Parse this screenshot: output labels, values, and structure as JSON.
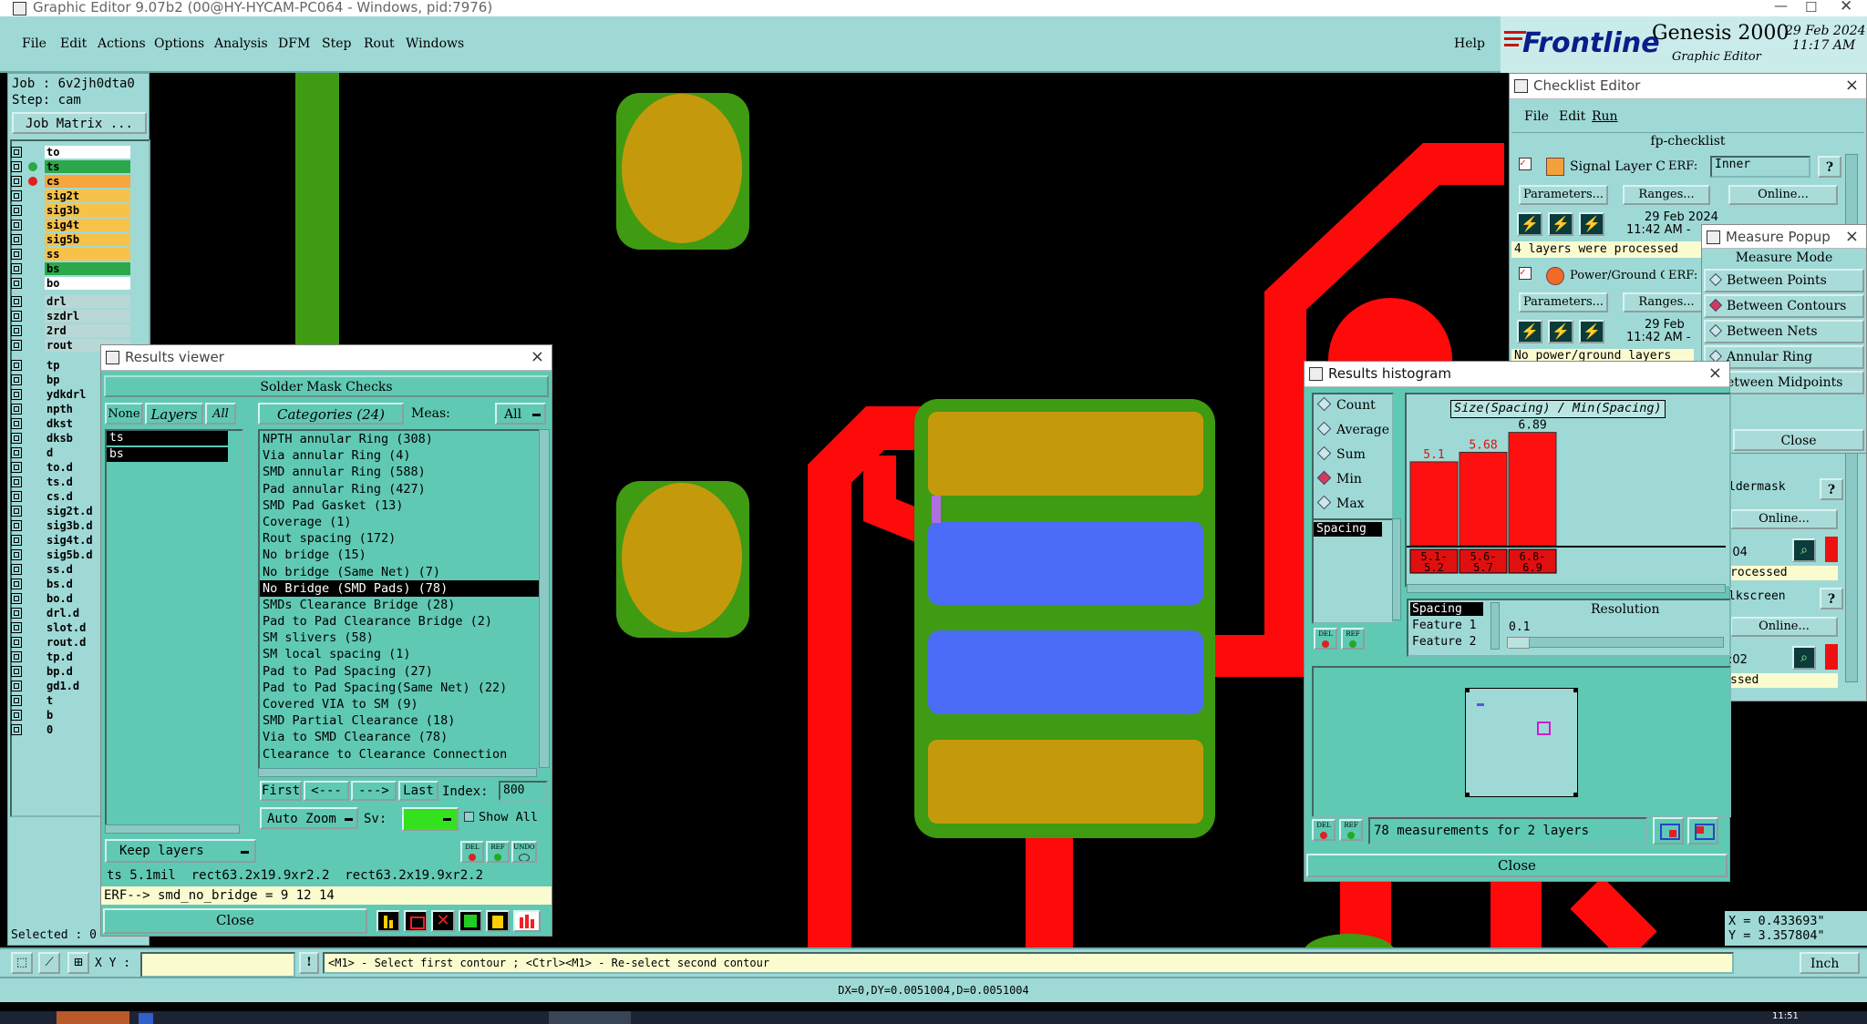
{
  "os_titlebar": "Graphic Editor 9.07b2 (00@HY-HYCAM-PC064 - Windows, pid:7976)",
  "menu": [
    "File",
    "Edit",
    "Actions",
    "Options",
    "Analysis",
    "DFM",
    "Step",
    "Rout",
    "Windows"
  ],
  "help_label": "Help",
  "brand": {
    "logo": "Frontline",
    "product": "Genesis 2000",
    "subtitle": "Graphic Editor",
    "date": "29 Feb 2024",
    "time": "11:17 AM"
  },
  "job": {
    "job_label": "Job : 6v2jh0dta0",
    "step_label": "Step: cam",
    "matrix_button": "Job Matrix ..."
  },
  "layers_group1": [
    {
      "name": "to",
      "color": "#ffffff",
      "dot": ""
    },
    {
      "name": "ts",
      "color": "#2aa84a",
      "dot": "#2aa84a"
    },
    {
      "name": "cs",
      "color": "#f6a63a",
      "dot": "#e02020"
    },
    {
      "name": "sig2t",
      "color": "#f6c24a",
      "dot": ""
    },
    {
      "name": "sig3b",
      "color": "#f6c24a",
      "dot": ""
    },
    {
      "name": "sig4t",
      "color": "#f6c24a",
      "dot": ""
    },
    {
      "name": "sig5b",
      "color": "#f6c24a",
      "dot": ""
    },
    {
      "name": "ss",
      "color": "#f6c24a",
      "dot": ""
    },
    {
      "name": "bs",
      "color": "#2aa84a",
      "dot": ""
    },
    {
      "name": "bo",
      "color": "#ffffff",
      "dot": ""
    }
  ],
  "layers_group2": [
    "drl",
    "szdrl",
    "2rd",
    "rout"
  ],
  "layers_group3": [
    "tp",
    "bp",
    "ydkdrl",
    "npth",
    "dkst",
    "dksb",
    "d",
    "to.d",
    "ts.d",
    "cs.d",
    "sig2t.d",
    "sig3b.d",
    "sig4t.d",
    "sig5b.d",
    "ss.d",
    "bs.d",
    "bo.d",
    "drl.d",
    "slot.d",
    "rout.d",
    "tp.d",
    "bp.d",
    "gd1.d",
    "t",
    "b",
    "0"
  ],
  "selected_label": "Selected : 0",
  "results_viewer": {
    "title": "Results viewer",
    "header": "Solder Mask Checks",
    "none_btn": "None",
    "layers_btn": "Layers",
    "all_btn": "All",
    "layers": [
      "ts",
      "bs"
    ],
    "categories_btn": "Categories (24)",
    "meas_label": "Meas:",
    "meas_value": "All",
    "categories": [
      "NPTH annular Ring (308)",
      "Via annular Ring (4)",
      "SMD annular Ring (588)",
      "Pad annular Ring (427)",
      "SMD Pad Gasket (13)",
      "Coverage (1)",
      "Rout spacing (172)",
      "No bridge (15)",
      "No bridge (Same Net) (7)",
      "No Bridge (SMD Pads) (78)",
      "SMDs Clearance Bridge (28)",
      "Pad to Pad Clearance Bridge (2)",
      "SM slivers (58)",
      "SM local spacing (1)",
      "Pad to Pad Spacing (27)",
      "Pad to Pad Spacing(Same Net) (22)",
      "Covered VIA to SM (9)",
      "SMD Partial Clearance (18)",
      "Via to SMD Clearance (78)",
      "Clearance to Clearance Connection"
    ],
    "selected_category": "No Bridge (SMD Pads) (78)",
    "nav": {
      "first": "First",
      "prev": "<---",
      "next": "--->",
      "last": "Last",
      "index_label": "Index:",
      "index_value": "800"
    },
    "auto_zoom": "Auto Zoom",
    "sv_label": "Sv:",
    "show_all": "Show All",
    "keep_layers": "Keep layers",
    "icon_labels": [
      "DEL",
      "REF",
      "UNDO"
    ],
    "info_line": "ts 5.1mil  rect63.2x19.9xr2.2  rect63.2x19.9xr2.2",
    "erf_line": "ERF--> smd_no_bridge = 9 12 14",
    "close": "Close"
  },
  "checklist": {
    "title": "Checklist Editor",
    "menu": [
      "File",
      "Edit",
      "Run"
    ],
    "name": "fp-checklist",
    "items": [
      {
        "label": "Signal Layer Ch",
        "erf": "ERF:",
        "erf_value": "Inner",
        "params": "Parameters...",
        "ranges": "Ranges...",
        "online": "Online...",
        "date": "29 Feb 2024",
        "time": "11:42 AM -",
        "status": "4 layers were processed"
      },
      {
        "label": "Power/Ground C",
        "erf": "ERF:",
        "erf_value": "",
        "params": "Parameters...",
        "ranges": "Ranges...",
        "online": "Online...",
        "date": "29 Feb",
        "time": "11:42 AM -",
        "status": "No power/ground layers"
      }
    ],
    "right_fragments": [
      "ldermask",
      "Online...",
      ":04",
      "rocessed",
      "lkscreen",
      "Online...",
      ":02",
      "ssed"
    ]
  },
  "measure_popup": {
    "title": "Measure Popup",
    "mode_label": "Measure Mode",
    "modes": [
      "Between Points",
      "Between Contours",
      "Between Nets",
      "Annular Ring",
      "etween Midpoints"
    ],
    "selected_mode": "Between Contours",
    "close": "Close"
  },
  "histogram": {
    "title": "Results histogram",
    "modes": [
      "Count",
      "Average",
      "Sum",
      "Min",
      "Max"
    ],
    "selected_mode": "Min",
    "list_item": "Spacing",
    "chart_title": "Size(Spacing) / Min(Spacing)",
    "fields": [
      "Spacing",
      "Feature 1",
      "Feature 2"
    ],
    "resolution_label": "Resolution",
    "resolution_value": "0.1",
    "measurements": "78 measurements for 2 layers",
    "close": "Close",
    "icon_labels": [
      "DEL",
      "REF"
    ]
  },
  "chart_data": {
    "type": "bar",
    "title": "Size(Spacing) / Min(Spacing)",
    "categories": [
      "5.1-5.2",
      "5.6-5.7",
      "6.8-6.9"
    ],
    "category_lines": [
      [
        "5.1-",
        "5.2"
      ],
      [
        "5.6-",
        "5.7"
      ],
      [
        "6.8-",
        "6.9"
      ]
    ],
    "values": [
      5.1,
      5.68,
      6.89
    ],
    "value_labels": [
      "5.1",
      "5.68",
      "6.89"
    ],
    "color": "#ff1010",
    "ylim": [
      0,
      7.2
    ]
  },
  "coords": {
    "x": "X = 0.433693\"",
    "y": "Y = 3.357804\""
  },
  "status": {
    "xy_label": "X Y :",
    "message": "<M1> - Select first contour ; <Ctrl><M1> - Re-select second contour",
    "unit": "Inch",
    "delta": "DX=0,DY=0.0051004,D=0.0051004"
  },
  "taskbar_time": "11:51"
}
